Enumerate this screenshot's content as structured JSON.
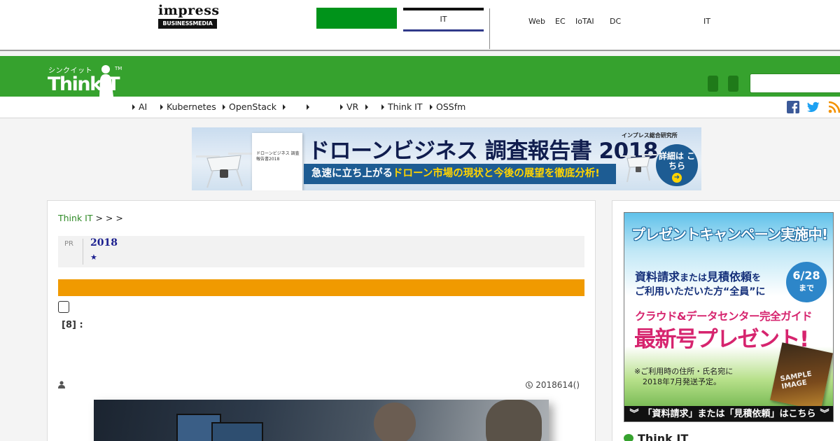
{
  "impress": {
    "logo_word": "impress",
    "logo_sub": "BUSINESSMEDIA",
    "it_tab": "IT",
    "links": [
      "Web",
      "EC",
      "IoTAI",
      "DC",
      "IT"
    ]
  },
  "header": {
    "logo_kana": "シンクイット",
    "logo_text": "ThinkIT",
    "logo_tm": "TM",
    "search_placeholder": ""
  },
  "nav": {
    "items": [
      "AI",
      "Kubernetes",
      "OpenStack",
      "",
      "",
      "VR",
      "",
      "Think IT",
      "OSSfm"
    ]
  },
  "banner": {
    "title": "ドローンビジネス 調査報告書 2018",
    "subtitle_pre": "急速に立ち上がる",
    "subtitle_highlight": "ドローン市場の現状と今後の展望を徹底分析!",
    "publisher": "インプレス総合研究所",
    "cta": "詳細は こちら",
    "report_cover": "ドローンビジネス 調査報告書2018"
  },
  "breadcrumb": {
    "home": "Think IT",
    "rest": " >  >  >"
  },
  "pr": {
    "label": "PR",
    "title": "2018",
    "star": "★"
  },
  "article": {
    "count_label": "[8] :",
    "date": "2018614()"
  },
  "sidebar": {
    "ad": {
      "title": "プレゼントキャンペーン実施中!",
      "line1_a": "資料請求",
      "line1_b": "または",
      "line1_c": "見積依頼",
      "line1_d": "を",
      "line2": "ご利用いただいた方“全員”に",
      "badge_date": "6/28",
      "badge_until": "まで",
      "line3": "クラウド&データセンター完全ガイド",
      "line4": "最新号プレゼント!",
      "note1": "※ご利用時の住所・氏名宛に",
      "note2": "2018年7月発送予定。",
      "book_label": "SAMPLE IMAGE",
      "cta": "「資料請求」または「見積依頼」はこちら"
    },
    "heading": "Think IT"
  },
  "colors": {
    "brand_green": "#36a22e",
    "impress_green": "#00931a",
    "orange": "#f09a00",
    "pr_title_blue": "#1b1f8f"
  }
}
